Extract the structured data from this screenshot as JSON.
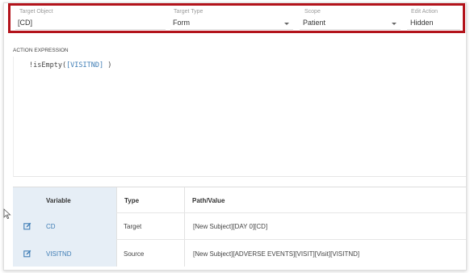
{
  "header": {
    "target_object": {
      "label": "Target Object",
      "value": "[CD]"
    },
    "target_type": {
      "label": "Target Type",
      "value": "Form"
    },
    "scope": {
      "label": "Scope",
      "value": "Patient"
    },
    "edit_action": {
      "label": "Edit Action",
      "value": "Hidden"
    }
  },
  "action_expression": {
    "title": "ACTION EXPRESSION",
    "code_prefix": "!isEmpty(",
    "code_var": "[VISITND]",
    "code_suffix": " )"
  },
  "table": {
    "headers": {
      "variable": "Variable",
      "type": "Type",
      "path": "Path/Value"
    },
    "rows": [
      {
        "variable": "CD",
        "type": "Target",
        "path": "[New Subject][DAY 0][CD]"
      },
      {
        "variable": "VISITND",
        "type": "Source",
        "path": "[New Subject][ADVERSE EVENTS][VISIT][Visit][VISITND]"
      }
    ]
  },
  "colors": {
    "highlight_border": "#b3131b",
    "link": "#3f7db5",
    "variable_column_bg": "#e6eef6"
  },
  "icons": {
    "row_edit": "edit-icon",
    "pointer": "mouse-cursor-icon"
  }
}
